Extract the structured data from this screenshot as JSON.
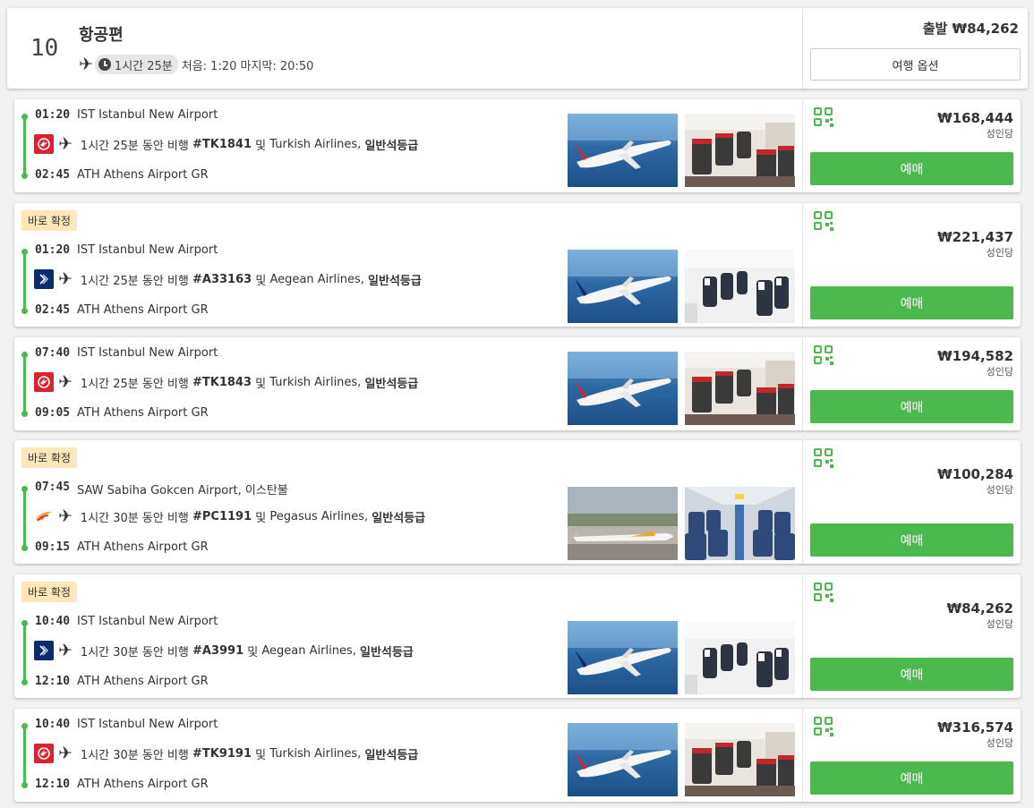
{
  "header": {
    "count": "10",
    "title": "항공편",
    "duration": "1시간 25분",
    "first_last": "처음: 1:20 마지막: 20:50",
    "departure_price": "출발 ₩84,262",
    "trip_options": "여행 옵션"
  },
  "labels": {
    "per_person": "성인당",
    "book": "예매",
    "instant": "바로 확정"
  },
  "colors": {
    "accent_green": "#4cb94f",
    "badge_bg": "#fde7b8",
    "turkish_red": "#d9232e",
    "aegean_blue": "#0b2b6a"
  },
  "flights": [
    {
      "dep_time": "01:20",
      "dep_airport": "IST Istanbul New Airport",
      "duration": "1시간 25분 동안 비행",
      "flight_no": "#TK1841",
      "conj": "및",
      "airline": "Turkish Airlines,",
      "cabin": "일반석등급",
      "arr_time": "02:45",
      "arr_airport": "ATH Athens Airport GR",
      "price": "₩168,444",
      "airline_logo": "turkish-airlines-logo",
      "instant": false
    },
    {
      "dep_time": "01:20",
      "dep_airport": "IST Istanbul New Airport",
      "duration": "1시간 25분 동안 비행",
      "flight_no": "#A33163",
      "conj": "및",
      "airline": "Aegean Airlines,",
      "cabin": "일반석등급",
      "arr_time": "02:45",
      "arr_airport": "ATH Athens Airport GR",
      "price": "₩221,437",
      "airline_logo": "aegean-airlines-logo",
      "instant": true
    },
    {
      "dep_time": "07:40",
      "dep_airport": "IST Istanbul New Airport",
      "duration": "1시간 25분 동안 비행",
      "flight_no": "#TK1843",
      "conj": "및",
      "airline": "Turkish Airlines,",
      "cabin": "일반석등급",
      "arr_time": "09:05",
      "arr_airport": "ATH Athens Airport GR",
      "price": "₩194,582",
      "airline_logo": "turkish-airlines-logo",
      "instant": false
    },
    {
      "dep_time": "07:45",
      "dep_airport": "SAW Sabiha Gokcen Airport, 이스탄불",
      "duration": "1시간 30분 동안 비행",
      "flight_no": "#PC1191",
      "conj": "및",
      "airline": "Pegasus Airlines,",
      "cabin": "일반석등급",
      "arr_time": "09:15",
      "arr_airport": "ATH Athens Airport GR",
      "price": "₩100,284",
      "airline_logo": "pegasus-airlines-logo",
      "instant": true
    },
    {
      "dep_time": "10:40",
      "dep_airport": "IST Istanbul New Airport",
      "duration": "1시간 30분 동안 비행",
      "flight_no": "#A3991",
      "conj": "및",
      "airline": "Aegean Airlines,",
      "cabin": "일반석등급",
      "arr_time": "12:10",
      "arr_airport": "ATH Athens Airport GR",
      "price": "₩84,262",
      "airline_logo": "aegean-airlines-logo",
      "instant": true
    },
    {
      "dep_time": "10:40",
      "dep_airport": "IST Istanbul New Airport",
      "duration": "1시간 30분 동안 비행",
      "flight_no": "#TK9191",
      "conj": "및",
      "airline": "Turkish Airlines,",
      "cabin": "일반석등급",
      "arr_time": "12:10",
      "arr_airport": "ATH Athens Airport GR",
      "price": "₩316,574",
      "airline_logo": "turkish-airlines-logo",
      "instant": false
    }
  ]
}
